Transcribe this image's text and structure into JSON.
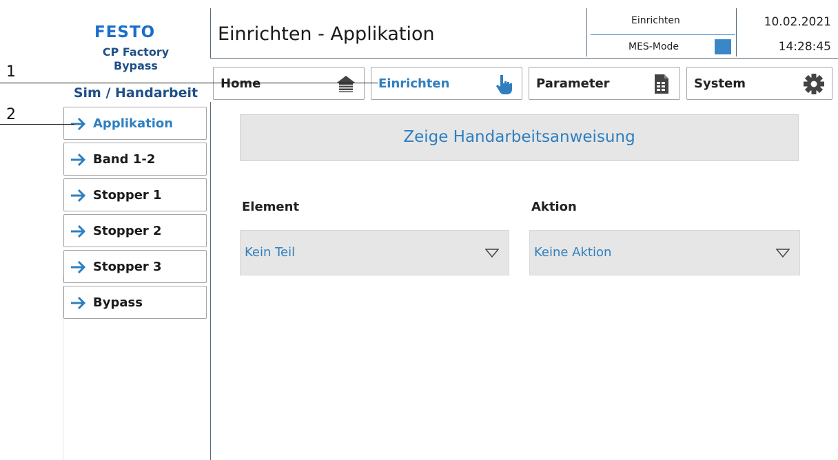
{
  "brand": {
    "logo": "FESTO",
    "line1": "CP Factory",
    "line2": "Bypass",
    "station": "Sim / Handarbeit"
  },
  "header": {
    "title": "Einrichten - Applikation",
    "mode": "Einrichten",
    "mes_label": "MES-Mode",
    "date": "10.02.2021",
    "time": "14:28:45",
    "mes_indicator_color": "#3a87c8"
  },
  "nav": [
    {
      "label": "Home",
      "icon": "home-icon"
    },
    {
      "label": "Einrichten",
      "icon": "hand-pointer-icon",
      "active": true
    },
    {
      "label": "Parameter",
      "icon": "document-icon"
    },
    {
      "label": "System",
      "icon": "gear-icon"
    }
  ],
  "sidebar": {
    "items": [
      {
        "label": "Applikation",
        "active": true
      },
      {
        "label": "Band 1-2"
      },
      {
        "label": "Stopper 1"
      },
      {
        "label": "Stopper 2"
      },
      {
        "label": "Stopper 3"
      },
      {
        "label": "Bypass"
      }
    ]
  },
  "main": {
    "show_instruction_button": "Zeige Handarbeitsanweisung",
    "element_label": "Element",
    "element_value": "Kein Teil",
    "action_label": "Aktion",
    "action_value": "Keine Aktion"
  },
  "annotations": {
    "a1": "1",
    "a2": "2"
  },
  "colors": {
    "accent": "#2f7fbf",
    "brand": "#1a6ec8",
    "panel": "#e6e6e6"
  }
}
